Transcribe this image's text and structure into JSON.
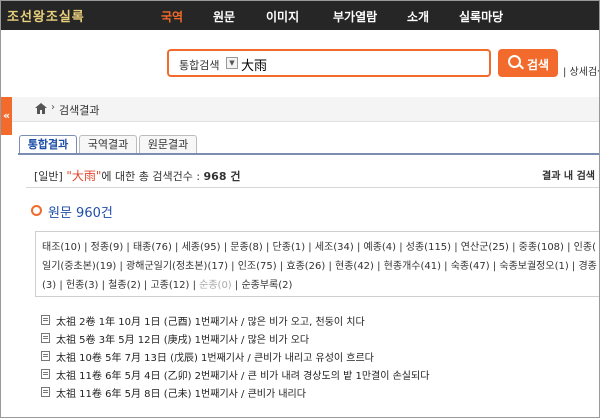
{
  "header": {
    "logo": "조선왕조실록",
    "nav": [
      "국역",
      "원문",
      "이미지",
      "부가열람",
      "소개",
      "실록마당"
    ]
  },
  "search": {
    "scope": "통합검색",
    "query": "大雨",
    "button_label": "검색",
    "detail_link": "| 상세검색"
  },
  "breadcrumb": {
    "current": "검색결과"
  },
  "tabs": [
    "통합결과",
    "국역결과",
    "원문결과"
  ],
  "summary": {
    "category": "[일반]",
    "keyword": "\"大雨\"",
    "text": "에 대한 총 검색건수 :",
    "count": "968 건"
  },
  "in_results_label": "결과 내 검색",
  "section": {
    "title": "원문 960건"
  },
  "kings": {
    "row1": "태조(10) | 정종(9) | 태종(76) | 세종(95) | 문종(8) | 단종(1) | 세조(34) | 예종(4) | 성종(115) | 연산군(25) | 중종(108) | 인종(",
    "row2": "일기(중초본)(19) | 광해군일기(정초본)(17) | 인조(75) | 효종(26) | 현종(42) | 현종개수(41) | 숙종(47) | 숙종보궐정오(1) | 경종",
    "row3_a": "(3) | 헌종(3) | 철종(2) | 고종(12) | ",
    "row3_disabled": "순종(0)",
    "row3_b": " | 순종부록(2)"
  },
  "results": [
    "太祖 2卷 1年 10月 1日 (己酉) 1번째기사 / 많은 비가 오고, 천둥이 치다",
    "太祖 5卷 3年 5月 12日 (庚戌) 1번째기사 / 많은 비가 오다",
    "太祖 10卷 5年 7月 13日 (戊辰) 1번째기사 / 큰비가 내리고 유성이 흐르다",
    "太祖 11卷 6年 5月 4日 (乙卯) 2번째기사 / 큰 비가 내려 경상도의 밭 1만결이 손실되다",
    "太祖 11卷 6年 5月 8日 (己未) 1번째기사 / 큰비가 내리다"
  ]
}
